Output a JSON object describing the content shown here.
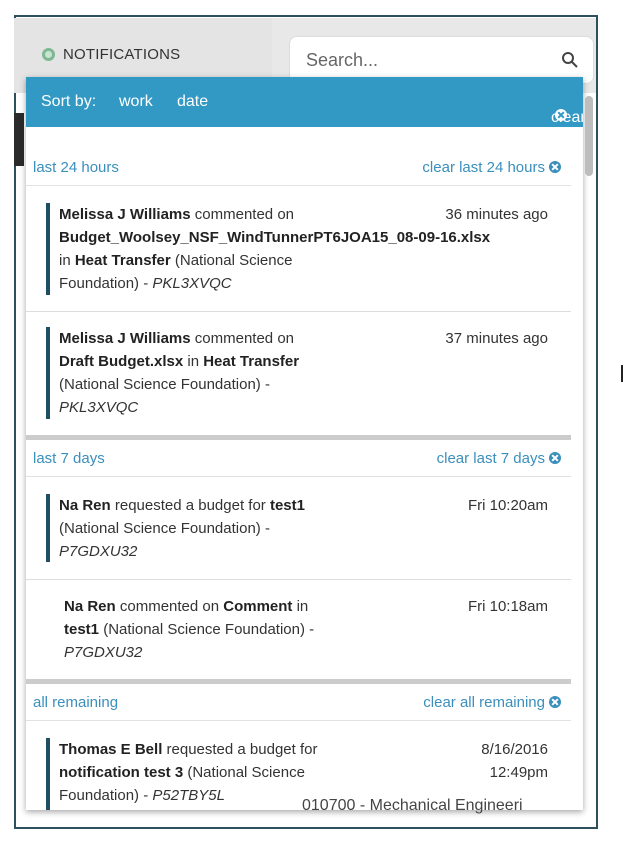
{
  "header": {
    "tab_label": "NOTIFICATIONS",
    "search_placeholder": "Search..."
  },
  "sortbar": {
    "label": "Sort by:",
    "options": [
      "work",
      "date"
    ],
    "clear_all": "clear all"
  },
  "groups": [
    {
      "label": "last 24 hours",
      "clear": "clear last 24 hours"
    },
    {
      "label": "last 7 days",
      "clear": "clear last 7 days"
    },
    {
      "label": "all remaining",
      "clear": "clear all remaining"
    }
  ],
  "items": [
    {
      "l1a": "Melissa J Williams",
      "l1b": " commented on",
      "l2": "Budget_Woolsey_NSF_WindTunnerPT6JOA15_08-09-16.xlsx",
      "l3a": "in ",
      "l3b": "Heat Transfer",
      "l3c": " (National Science",
      "l4a": "Foundation) - ",
      "l4b": "PKL3XVQC",
      "time": "36 minutes ago"
    },
    {
      "l1a": "Melissa J Williams",
      "l1b": " commented on",
      "l2a": "Draft Budget.xlsx",
      "l2b": " in ",
      "l2c": "Heat Transfer",
      "l3": "(National Science Foundation) -",
      "l4": "PKL3XVQC",
      "time": "37 minutes ago"
    },
    {
      "l1a": "Na Ren",
      "l1b": " requested a budget for ",
      "l1c": "test1",
      "l2": "(National Science Foundation) -",
      "l3": "P7GDXU32",
      "time": "Fri 10:20am"
    },
    {
      "l1a": "Na Ren",
      "l1b": " commented on ",
      "l1c": "Comment",
      "l1d": " in",
      "l2a": "test1",
      "l2b": " (National Science Foundation) -",
      "l3": "P7GDXU32",
      "time": "Fri 10:18am"
    },
    {
      "l1a": "Thomas E Bell",
      "l1b": " requested a budget for",
      "l2a": "notification test 3",
      "l2b": " (National Science",
      "l3a": "Foundation) - ",
      "l3b": "P52TBY5L",
      "time1": "8/16/2016",
      "time2": "12:49pm"
    }
  ],
  "underlay_text": "010700 - Mechanical Engineeri"
}
